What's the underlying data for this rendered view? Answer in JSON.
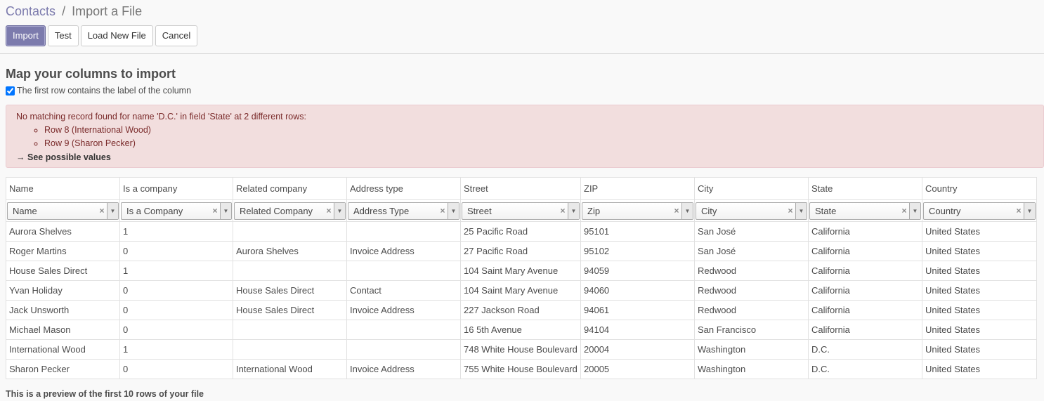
{
  "breadcrumb": {
    "parent": "Contacts",
    "separator": "/",
    "current": "Import a File"
  },
  "buttons": {
    "import": "Import",
    "test": "Test",
    "load": "Load New File",
    "cancel": "Cancel"
  },
  "heading": "Map your columns to import",
  "first_row_checkbox": {
    "label": "The first row contains the label of the column",
    "checked": true
  },
  "alert": {
    "message": "No matching record found for name 'D.C.' in field 'State' at 2 different rows:",
    "rows": [
      "Row 8 (International Wood)",
      "Row 9 (Sharon Pecker)"
    ],
    "link_arrow": "→",
    "link": "See possible values"
  },
  "table": {
    "headers": [
      "Name",
      "Is a company",
      "Related company",
      "Address type",
      "Street",
      "ZIP",
      "City",
      "State",
      "Country"
    ],
    "mapping": [
      "Name",
      "Is a Company",
      "Related Company",
      "Address Type",
      "Street",
      "Zip",
      "City",
      "State",
      "Country"
    ],
    "rows": [
      [
        "Aurora Shelves",
        "1",
        "",
        "",
        "25 Pacific Road",
        "95101",
        "San José",
        "California",
        "United States"
      ],
      [
        "Roger Martins",
        "0",
        "Aurora Shelves",
        "Invoice Address",
        "27 Pacific Road",
        "95102",
        "San José",
        "California",
        "United States"
      ],
      [
        "House Sales Direct",
        "1",
        "",
        "",
        "104 Saint Mary Avenue",
        "94059",
        "Redwood",
        "California",
        "United States"
      ],
      [
        "Yvan Holiday",
        "0",
        "House Sales Direct",
        "Contact",
        "104 Saint Mary Avenue",
        "94060",
        "Redwood",
        "California",
        "United States"
      ],
      [
        "Jack Unsworth",
        "0",
        "House Sales Direct",
        "Invoice Address",
        "227 Jackson Road",
        "94061",
        "Redwood",
        "California",
        "United States"
      ],
      [
        "Michael Mason",
        "0",
        "",
        "",
        "16 5th Avenue",
        "94104",
        "San Francisco",
        "California",
        "United States"
      ],
      [
        "International Wood",
        "1",
        "",
        "",
        "748 White House Boulevard",
        "20004",
        "Washington",
        "D.C.",
        "United States"
      ],
      [
        "Sharon Pecker",
        "0",
        "International Wood",
        "Invoice Address",
        "755 White House Boulevard",
        "20005",
        "Washington",
        "D.C.",
        "United States"
      ]
    ]
  },
  "clear_glyph": "×",
  "arrow_glyph": "▼",
  "footer": "This is a preview of the first 10 rows of your file"
}
